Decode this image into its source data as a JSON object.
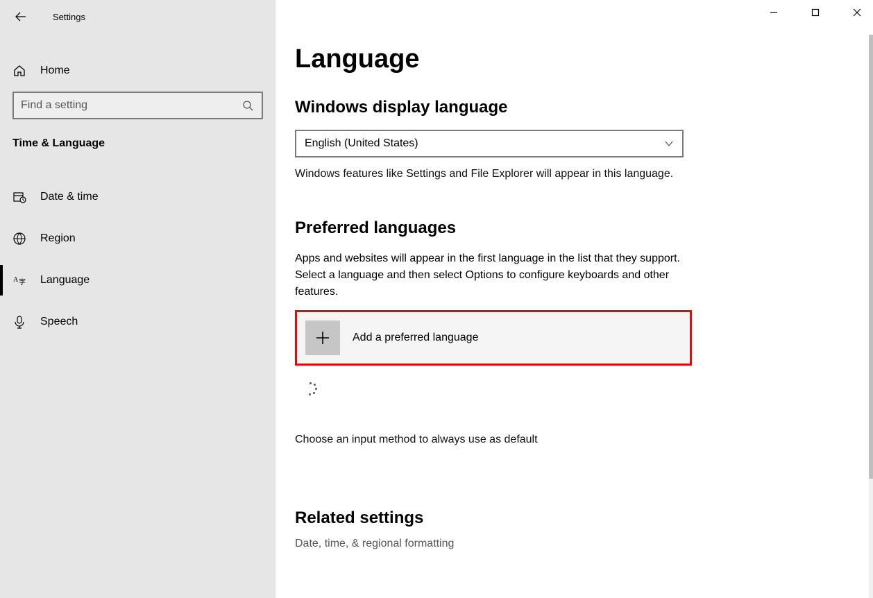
{
  "app": {
    "title": "Settings"
  },
  "sidebar": {
    "home_label": "Home",
    "search_placeholder": "Find a setting",
    "category_title": "Time & Language",
    "items": [
      {
        "label": "Date & time",
        "icon": "calendar-clock-icon"
      },
      {
        "label": "Region",
        "icon": "globe-icon"
      },
      {
        "label": "Language",
        "icon": "language-icon",
        "active": true
      },
      {
        "label": "Speech",
        "icon": "microphone-icon"
      }
    ]
  },
  "main": {
    "page_title": "Language",
    "display_language": {
      "title": "Windows display language",
      "selected": "English (United States)",
      "description": "Windows features like Settings and File Explorer will appear in this language."
    },
    "preferred": {
      "title": "Preferred languages",
      "description": "Apps and websites will appear in the first language in the list that they support. Select a language and then select Options to configure keyboards and other features.",
      "add_label": "Add a preferred language"
    },
    "input_method_link": "Choose an input method to always use as default",
    "related": {
      "title": "Related settings",
      "link": "Date, time, & regional formatting"
    }
  }
}
